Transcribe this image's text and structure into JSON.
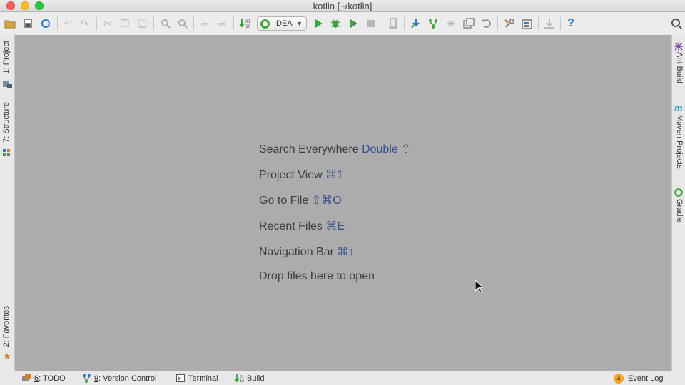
{
  "window": {
    "title": "kotlin [~/kotlin]"
  },
  "toolbar": {
    "run_config": "IDEA",
    "icons": [
      "open-folder",
      "save",
      "sync",
      "undo",
      "redo",
      "cut",
      "copy",
      "paste",
      "find",
      "replace",
      "back",
      "forward",
      "make",
      "run",
      "debug",
      "coverage",
      "stop",
      "attach",
      "vcs-update",
      "vcs-commit",
      "vcs-compare",
      "vcs-history",
      "vcs-revert",
      "settings",
      "project-structure",
      "sdk",
      "help",
      "search-everywhere"
    ]
  },
  "left_strip": {
    "project": {
      "num": "1",
      "label": ": Project"
    },
    "structure": {
      "num": "7",
      "label": ": Structure"
    },
    "favorites": {
      "num": "2",
      "label": ": Favorites"
    }
  },
  "right_strip": {
    "ant": "Ant Build",
    "maven": "Maven Projects",
    "gradle": "Gradle"
  },
  "hints": [
    {
      "text": "Search Everywhere",
      "key": "Double ⇧"
    },
    {
      "text": "Project View",
      "key": "⌘1"
    },
    {
      "text": "Go to File",
      "key": "⇧⌘O"
    },
    {
      "text": "Recent Files",
      "key": "⌘E"
    },
    {
      "text": "Navigation Bar",
      "key": "⌘↑"
    },
    {
      "text": "Drop files here to open",
      "key": ""
    }
  ],
  "status": {
    "todo": {
      "num": "6",
      "label": ": TODO"
    },
    "vcs": {
      "num": "9",
      "label": ": Version Control"
    },
    "terminal": "Terminal",
    "build": "Build",
    "event_count": "4",
    "event_log": "Event Log"
  },
  "colors": {
    "editor_bg": "#acacac",
    "key_text": "#34508b",
    "run_green": "#3fa33f"
  }
}
